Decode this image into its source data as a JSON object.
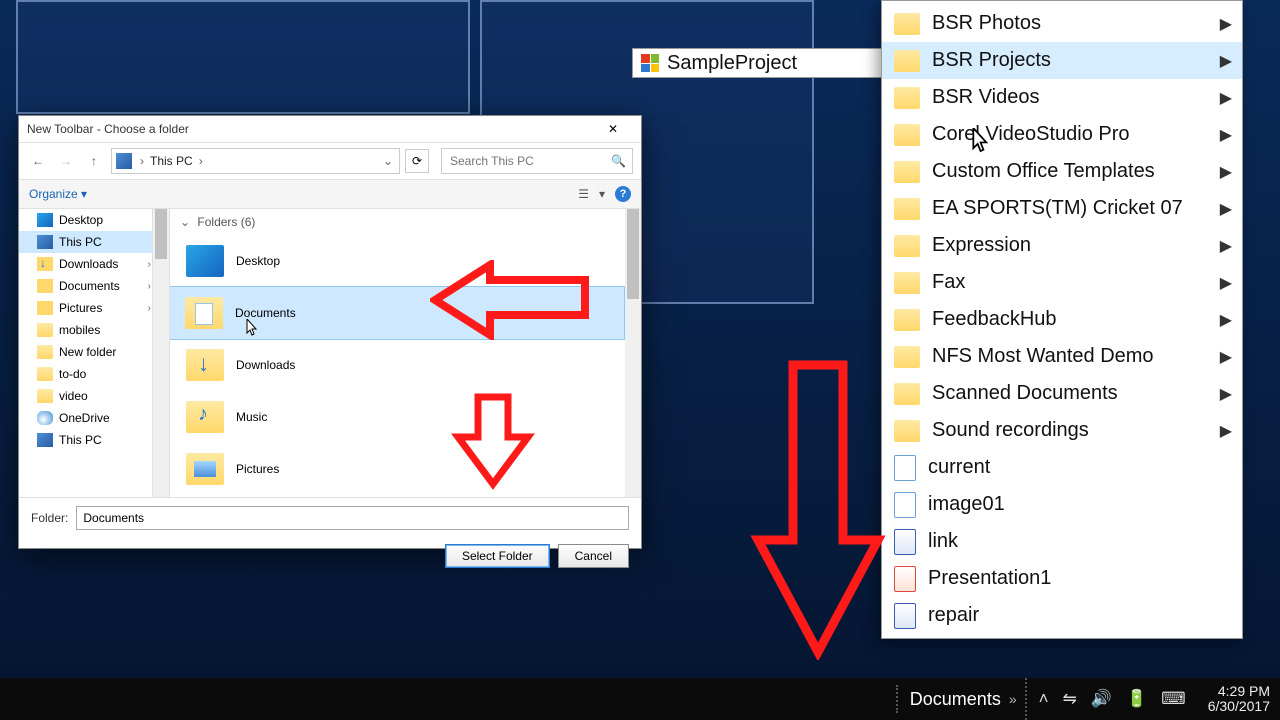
{
  "dialog": {
    "title": "New Toolbar - Choose a folder",
    "nav": {
      "back": "←",
      "fwd": "→",
      "up": "↑",
      "refresh": "⟳"
    },
    "address": {
      "location": "This PC",
      "chev": "›",
      "dropdown": "⌄"
    },
    "search": {
      "placeholder": "Search This PC",
      "icon": "🔍"
    },
    "toolbar": {
      "organize": "Organize ▾",
      "view_icon": "☰",
      "help": "?"
    },
    "sidebar": [
      {
        "label": "Desktop",
        "icon": "ico-desktop",
        "expand": ""
      },
      {
        "label": "This PC",
        "icon": "ico-pc",
        "expand": "",
        "sel": true
      },
      {
        "label": "Downloads",
        "icon": "ico-dl",
        "expand": "›"
      },
      {
        "label": "Documents",
        "icon": "ico-doc",
        "expand": "›"
      },
      {
        "label": "Pictures",
        "icon": "ico-pic",
        "expand": "›"
      },
      {
        "label": "mobiles",
        "icon": "ico-folder",
        "expand": ""
      },
      {
        "label": "New folder",
        "icon": "ico-folder",
        "expand": ""
      },
      {
        "label": "to-do",
        "icon": "ico-folder",
        "expand": ""
      },
      {
        "label": "video",
        "icon": "ico-folder",
        "expand": ""
      },
      {
        "label": "OneDrive",
        "icon": "ico-cloud",
        "expand": ""
      },
      {
        "label": "This PC",
        "icon": "ico-pc",
        "expand": ""
      }
    ],
    "section_header": "Folders (6)",
    "folders": [
      {
        "label": "Desktop",
        "cls": "desktop"
      },
      {
        "label": "Documents",
        "cls": "doc",
        "sel": true
      },
      {
        "label": "Downloads",
        "cls": "dl"
      },
      {
        "label": "Music",
        "cls": "music"
      },
      {
        "label": "Pictures",
        "cls": "pic"
      }
    ],
    "folder_label": "Folder:",
    "folder_value": "Documents",
    "select_btn": "Select Folder",
    "cancel_btn": "Cancel",
    "close": "✕"
  },
  "flyout": {
    "label": "SampleProject"
  },
  "menu": {
    "items": [
      {
        "label": "BSR Photos",
        "sub": true,
        "ico": "folder"
      },
      {
        "label": "BSR Projects",
        "sub": true,
        "ico": "folder",
        "hl": true
      },
      {
        "label": "BSR Videos",
        "sub": true,
        "ico": "folder"
      },
      {
        "label": "Corel VideoStudio Pro",
        "sub": true,
        "ico": "folder"
      },
      {
        "label": "Custom Office Templates",
        "sub": true,
        "ico": "folder"
      },
      {
        "label": "EA SPORTS(TM) Cricket 07",
        "sub": true,
        "ico": "folder"
      },
      {
        "label": "Expression",
        "sub": true,
        "ico": "folder"
      },
      {
        "label": "Fax",
        "sub": true,
        "ico": "folder"
      },
      {
        "label": "FeedbackHub",
        "sub": true,
        "ico": "folder"
      },
      {
        "label": "NFS Most Wanted Demo",
        "sub": true,
        "ico": "folder"
      },
      {
        "label": "Scanned Documents",
        "sub": true,
        "ico": "folder"
      },
      {
        "label": "Sound recordings",
        "sub": true,
        "ico": "folder"
      },
      {
        "label": "current",
        "sub": false,
        "ico": "file"
      },
      {
        "label": "image01",
        "sub": false,
        "ico": "file"
      },
      {
        "label": "link",
        "sub": false,
        "ico": "file word"
      },
      {
        "label": "Presentation1",
        "sub": false,
        "ico": "file red"
      },
      {
        "label": "repair",
        "sub": false,
        "ico": "file word"
      }
    ]
  },
  "taskbar": {
    "toolbar_label": "Documents",
    "chevron": "»",
    "tray": [
      "˄",
      "⇋",
      "🔊",
      "🔋",
      "⌨"
    ],
    "time": "4:29 PM",
    "date": "6/30/2017"
  },
  "annotation": {
    "arrow_left_color": "#ff1a1a",
    "arrow_down_color": "#ff1a1a"
  }
}
